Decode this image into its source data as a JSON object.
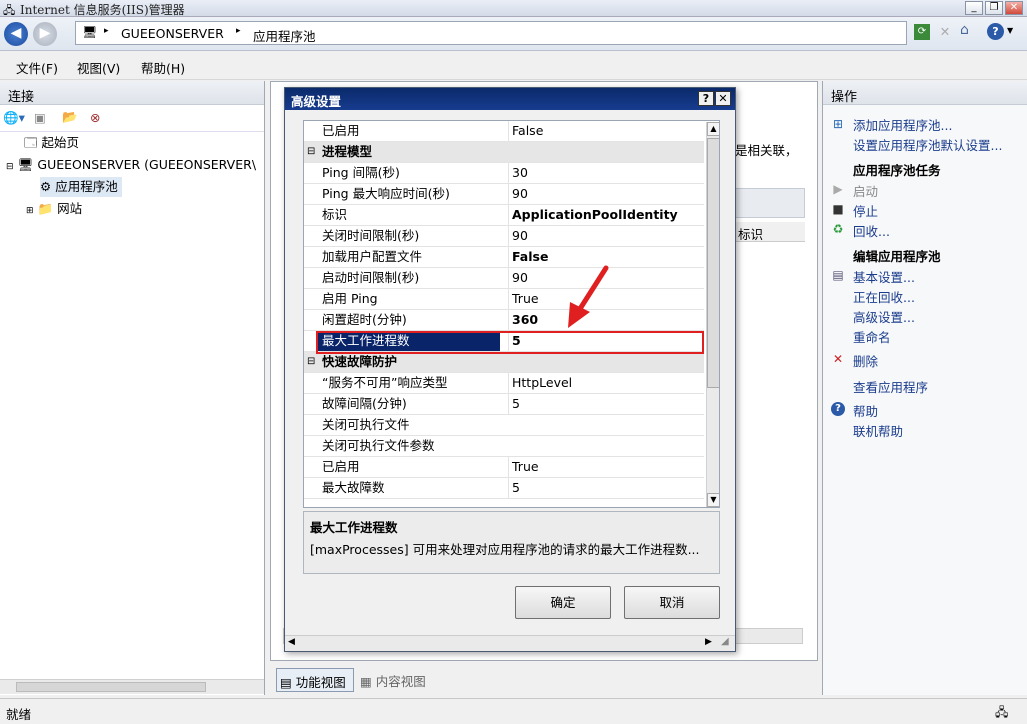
{
  "window": {
    "title": "Internet 信息服务(IIS)管理器",
    "min": "_",
    "max": "❐",
    "close": "✕"
  },
  "address": {
    "server": "GUEEONSERVER",
    "page": "应用程序池",
    "sep": "▸"
  },
  "menu": [
    "文件(F)",
    "视图(V)",
    "帮助(H)"
  ],
  "connections": {
    "title": "连接",
    "tree": {
      "start": "起始页",
      "server": "GUEEONSERVER (GUEEONSERVER\\",
      "apppools": "应用程序池",
      "sites": "网站"
    }
  },
  "center": {
    "partial_text": "是相关联，",
    "column": "标识",
    "bottom_tabs": [
      "功能视图",
      "内容视图"
    ]
  },
  "actions": {
    "title": "操作",
    "items": {
      "add_pool": "添加应用程序池...",
      "set_defaults": "设置应用程序池默认设置...",
      "pool_tasks": "应用程序池任务",
      "start": "启动",
      "stop": "停止",
      "recycle": "回收...",
      "edit_pool": "编辑应用程序池",
      "basic": "基本设置...",
      "recycling": "正在回收...",
      "advanced": "高级设置...",
      "rename": "重命名",
      "delete": "删除",
      "view_apps": "查看应用程序",
      "help": "帮助",
      "online_help": "联机帮助"
    }
  },
  "status": {
    "text": "就绪"
  },
  "dialog": {
    "title": "高级设置",
    "help": "?",
    "close": "✕",
    "rows": [
      {
        "name": "已启用",
        "value": "False"
      },
      {
        "name": "进程模型",
        "value": "",
        "cat": true
      },
      {
        "name": "Ping 间隔(秒)",
        "value": "30"
      },
      {
        "name": "Ping 最大响应时间(秒)",
        "value": "90"
      },
      {
        "name": "标识",
        "value": "ApplicationPoolIdentity",
        "bold": true
      },
      {
        "name": "关闭时间限制(秒)",
        "value": "90"
      },
      {
        "name": "加载用户配置文件",
        "value": "False",
        "bold": true
      },
      {
        "name": "启动时间限制(秒)",
        "value": "90"
      },
      {
        "name": "启用 Ping",
        "value": "True"
      },
      {
        "name": "闲置超时(分钟)",
        "value": "360",
        "bold": true
      },
      {
        "name": "最大工作进程数",
        "value": "5",
        "bold": true,
        "sel": true
      },
      {
        "name": "快速故障防护",
        "value": "",
        "cat": true
      },
      {
        "name": "“服务不可用”响应类型",
        "value": "HttpLevel"
      },
      {
        "name": "故障间隔(分钟)",
        "value": "5"
      },
      {
        "name": "关闭可执行文件",
        "value": ""
      },
      {
        "name": "关闭可执行文件参数",
        "value": ""
      },
      {
        "name": "已启用",
        "value": "True"
      },
      {
        "name": "最大故障数",
        "value": "5"
      }
    ],
    "desc_title": "最大工作进程数",
    "desc_text": "[maxProcesses] 可用来处理对应用程序池的请求的最大工作进程数...",
    "ok": "确定",
    "cancel": "取消"
  },
  "colors": {
    "title_bar": "#0b2a6b",
    "selection": "#0a246a",
    "highlight_box": "#e02020",
    "arrow": "#e02020",
    "link": "#1a3c8c"
  }
}
